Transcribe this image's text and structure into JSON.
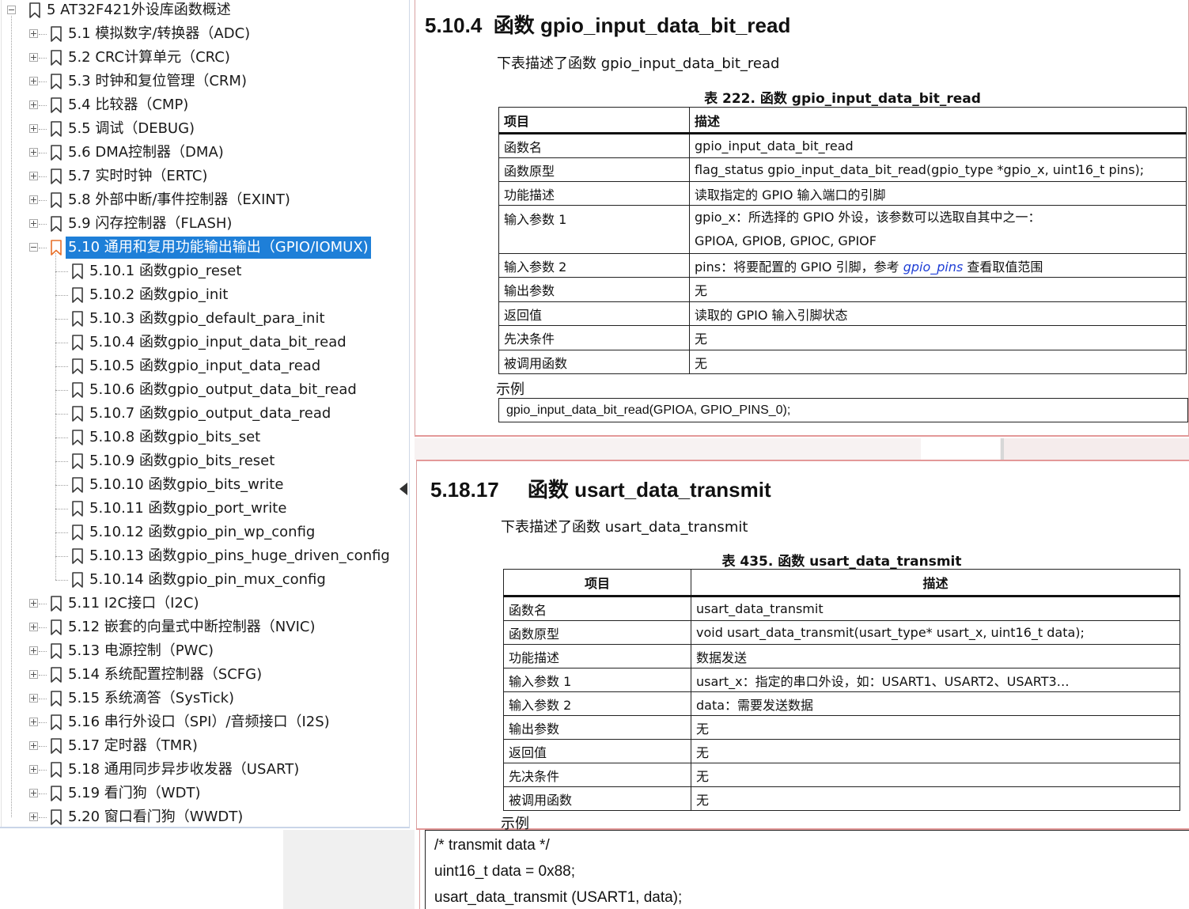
{
  "tree": {
    "items": [
      {
        "label": "5 AT32F421外设库函数概述",
        "level": 0,
        "expanded": true
      },
      {
        "label": "5.1 模拟数字/转换器（ADC)",
        "level": 1
      },
      {
        "label": "5.2 CRC计算单元（CRC)",
        "level": 1
      },
      {
        "label": "5.3 时钟和复位管理（CRM)",
        "level": 1
      },
      {
        "label": "5.4 比较器（CMP)",
        "level": 1
      },
      {
        "label": "5.5 调试（DEBUG)",
        "level": 1
      },
      {
        "label": "5.6 DMA控制器（DMA)",
        "level": 1
      },
      {
        "label": "5.7 实时时钟（ERTC)",
        "level": 1
      },
      {
        "label": "5.8 外部中断/事件控制器（EXINT)",
        "level": 1
      },
      {
        "label": "5.9 闪存控制器（FLASH)",
        "level": 1
      },
      {
        "label": "5.10 通用和复用功能输出输出（GPIO/IOMUX)",
        "level": 1,
        "expanded": true,
        "selected": true
      },
      {
        "label": "5.10.1 函数gpio_reset",
        "level": 2
      },
      {
        "label": "5.10.2 函数gpio_init",
        "level": 2
      },
      {
        "label": "5.10.3 函数gpio_default_para_init",
        "level": 2
      },
      {
        "label": "5.10.4 函数gpio_input_data_bit_read",
        "level": 2
      },
      {
        "label": "5.10.5 函数gpio_input_data_read",
        "level": 2
      },
      {
        "label": "5.10.6 函数gpio_output_data_bit_read",
        "level": 2
      },
      {
        "label": "5.10.7 函数gpio_output_data_read",
        "level": 2
      },
      {
        "label": "5.10.8 函数gpio_bits_set",
        "level": 2
      },
      {
        "label": "5.10.9 函数gpio_bits_reset",
        "level": 2
      },
      {
        "label": "5.10.10 函数gpio_bits_write",
        "level": 2
      },
      {
        "label": "5.10.11 函数gpio_port_write",
        "level": 2
      },
      {
        "label": "5.10.12 函数gpio_pin_wp_config",
        "level": 2
      },
      {
        "label": "5.10.13 函数gpio_pins_huge_driven_config",
        "level": 2
      },
      {
        "label": "5.10.14 函数gpio_pin_mux_config",
        "level": 2
      },
      {
        "label": "5.11 I2C接口（I2C)",
        "level": 1
      },
      {
        "label": "5.12 嵌套的向量式中断控制器（NVIC)",
        "level": 1
      },
      {
        "label": "5.13 电源控制（PWC)",
        "level": 1
      },
      {
        "label": "5.14 系统配置控制器（SCFG)",
        "level": 1
      },
      {
        "label": "5.15 系统滴答（SysTick)",
        "level": 1
      },
      {
        "label": "5.16 串行外设口（SPI）/音频接口（I2S)",
        "level": 1
      },
      {
        "label": "5.17 定时器（TMR)",
        "level": 1
      },
      {
        "label": "5.18 通用同步异步收发器（USART)",
        "level": 1
      },
      {
        "label": "5.19 看门狗（WDT)",
        "level": 1
      },
      {
        "label": "5.20 窗口看门狗（WWDT)",
        "level": 1
      }
    ]
  },
  "doc_top": {
    "section_num": "5.10.4",
    "section_title": "函数 gpio_input_data_bit_read",
    "intro": "下表描述了函数 gpio_input_data_bit_read",
    "table_caption": "表 222.  函数 gpio_input_data_bit_read",
    "col_item": "项目",
    "col_desc": "描述",
    "rows": {
      "name_k": "函数名",
      "name_v": "gpio_input_data_bit_read",
      "proto_k": "函数原型",
      "proto_v": "flag_status gpio_input_data_bit_read(gpio_type *gpio_x, uint16_t pins);",
      "func_k": "功能描述",
      "func_v": "读取指定的 GPIO 输入端口的引脚",
      "in1_k": "输入参数 1",
      "in1_v1": "gpio_x：所选择的 GPIO 外设，该参数可以选取自其中之一：",
      "in1_v2": "GPIOA, GPIOB, GPIOC, GPIOF",
      "in2_k": "输入参数 2",
      "in2_pre": "pins：将要配置的 GPIO 引脚，参考 ",
      "in2_link": "gpio_pins",
      "in2_post": " 查看取值范围",
      "out_k": "输出参数",
      "out_v": "无",
      "ret_k": "返回值",
      "ret_v": "读取的 GPIO 输入引脚状态",
      "pre_k": "先决条件",
      "pre_v": "无",
      "called_k": "被调用函数",
      "called_v": "无"
    },
    "example_label": "示例",
    "example_code": "gpio_input_data_bit_read(GPIOA, GPIO_PINS_0);"
  },
  "doc_bottom": {
    "section_num": "5.18.17",
    "section_title": "函数 usart_data_transmit",
    "intro": "下表描述了函数 usart_data_transmit",
    "table_caption": "表 435.  函数 usart_data_transmit",
    "col_item": "项目",
    "col_desc": "描述",
    "rows": {
      "name_k": "函数名",
      "name_v": "usart_data_transmit",
      "proto_k": "函数原型",
      "proto_v": "void usart_data_transmit(usart_type* usart_x, uint16_t data);",
      "func_k": "功能描述",
      "func_v": "数据发送",
      "in1_k": "输入参数 1",
      "in1_v": "usart_x：指定的串口外设，如：USART1、USART2、USART3…",
      "in2_k": "输入参数 2",
      "in2_v": "data：需要发送数据",
      "out_k": "输出参数",
      "out_v": "无",
      "ret_k": "返回值",
      "ret_v": "无",
      "pre_k": "先决条件",
      "pre_v": "无",
      "called_k": "被调用函数",
      "called_v": "无"
    },
    "example_label": "示例",
    "code_lines": [
      "/* transmit data */",
      "uint16_t data = 0x88;",
      "usart_data_transmit (USART1, data);"
    ]
  },
  "colors": {
    "selection": "#1e7fd8",
    "bookmark_selected": "#e8702a",
    "link": "#1f3fd6",
    "pane_border": "#e39999"
  }
}
